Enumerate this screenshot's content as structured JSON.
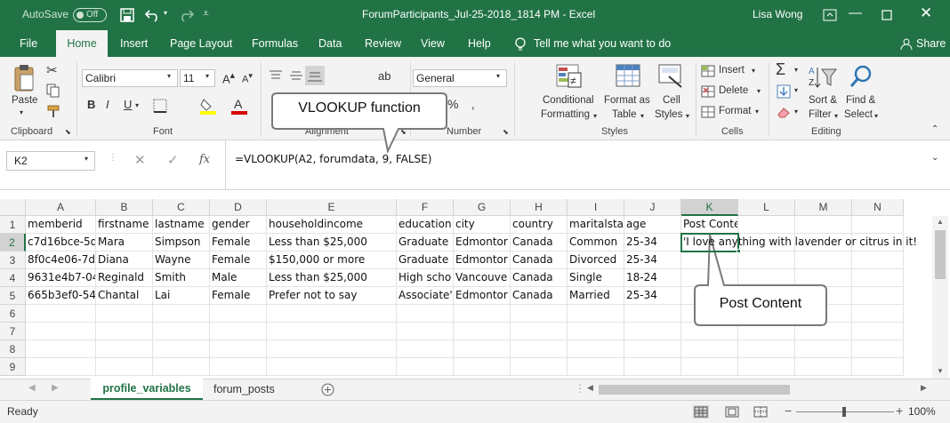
{
  "titlebar": {
    "autosave_label": "AutoSave",
    "autosave_state": "Off",
    "doc_title": "ForumParticipants_Jul-25-2018_1814 PM  -  Excel",
    "user": "Lisa Wong"
  },
  "tabs": [
    "File",
    "Home",
    "Insert",
    "Page Layout",
    "Formulas",
    "Data",
    "Review",
    "View",
    "Help"
  ],
  "tell_me": "Tell me what you want to do",
  "share": "Share",
  "ribbon": {
    "clipboard": {
      "paste": "Paste",
      "label": "Clipboard"
    },
    "font": {
      "name": "Calibri",
      "size": "11",
      "label": "Font",
      "bold": "B",
      "italic": "I",
      "underline": "U"
    },
    "alignment": {
      "label": "Alignment",
      "wrap": "ab"
    },
    "number": {
      "format": "General",
      "label": "Number",
      "percent": "%"
    },
    "styles": {
      "conditional_1": "Conditional",
      "conditional_2": "Formatting",
      "format_as_1": "Format as",
      "format_as_2": "Table",
      "cell_1": "Cell",
      "cell_2": "Styles",
      "label": "Styles"
    },
    "cells": {
      "insert": "Insert",
      "delete": "Delete",
      "format": "Format",
      "label": "Cells"
    },
    "editing": {
      "sort_1": "Sort &",
      "sort_2": "Filter",
      "find_1": "Find &",
      "find_2": "Select",
      "label": "Editing"
    }
  },
  "formula_bar": {
    "name_box": "K2",
    "fx": "fx",
    "formula": "=VLOOKUP(A2, forumdata, 9, FALSE)"
  },
  "columns": [
    "A",
    "B",
    "C",
    "D",
    "E",
    "F",
    "G",
    "H",
    "I",
    "J",
    "K",
    "L",
    "M",
    "N"
  ],
  "rows": [
    "1",
    "2",
    "3",
    "4",
    "5",
    "6",
    "7",
    "8",
    "9"
  ],
  "cells": [
    [
      "memberid",
      "firstname",
      "lastname",
      "gender",
      "householdincome",
      "education",
      "city",
      "country",
      "maritalsta",
      "age",
      "Post Content"
    ],
    [
      "c7d16bce-5d",
      "Mara",
      "Simpson",
      "Female",
      "Less than $25,000",
      "Graduate",
      "Edmontor",
      "Canada",
      "Common",
      "25-34",
      "'I love anything with lavender or citrus in it!"
    ],
    [
      "8f0c4e06-7d5",
      "Diana",
      "Wayne",
      "Female",
      "$150,000 or more",
      "Graduate",
      "Edmontor",
      "Canada",
      "Divorced",
      "25-34",
      ""
    ],
    [
      "9631e4b7-04",
      "Reginald",
      "Smith",
      "Male",
      "Less than $25,000",
      "High scho",
      "Vancouve",
      "Canada",
      "Single",
      "18-24",
      ""
    ],
    [
      "665b3ef0-54",
      "Chantal",
      "Lai",
      "Female",
      "Prefer not to say",
      "Associate'",
      "Edmontor",
      "Canada",
      "Married",
      "25-34",
      ""
    ]
  ],
  "sheets": [
    "profile_variables",
    "forum_posts"
  ],
  "status": {
    "ready": "Ready",
    "zoom": "100%"
  },
  "callouts": {
    "vlookup": "VLOOKUP function",
    "post": "Post Content"
  }
}
